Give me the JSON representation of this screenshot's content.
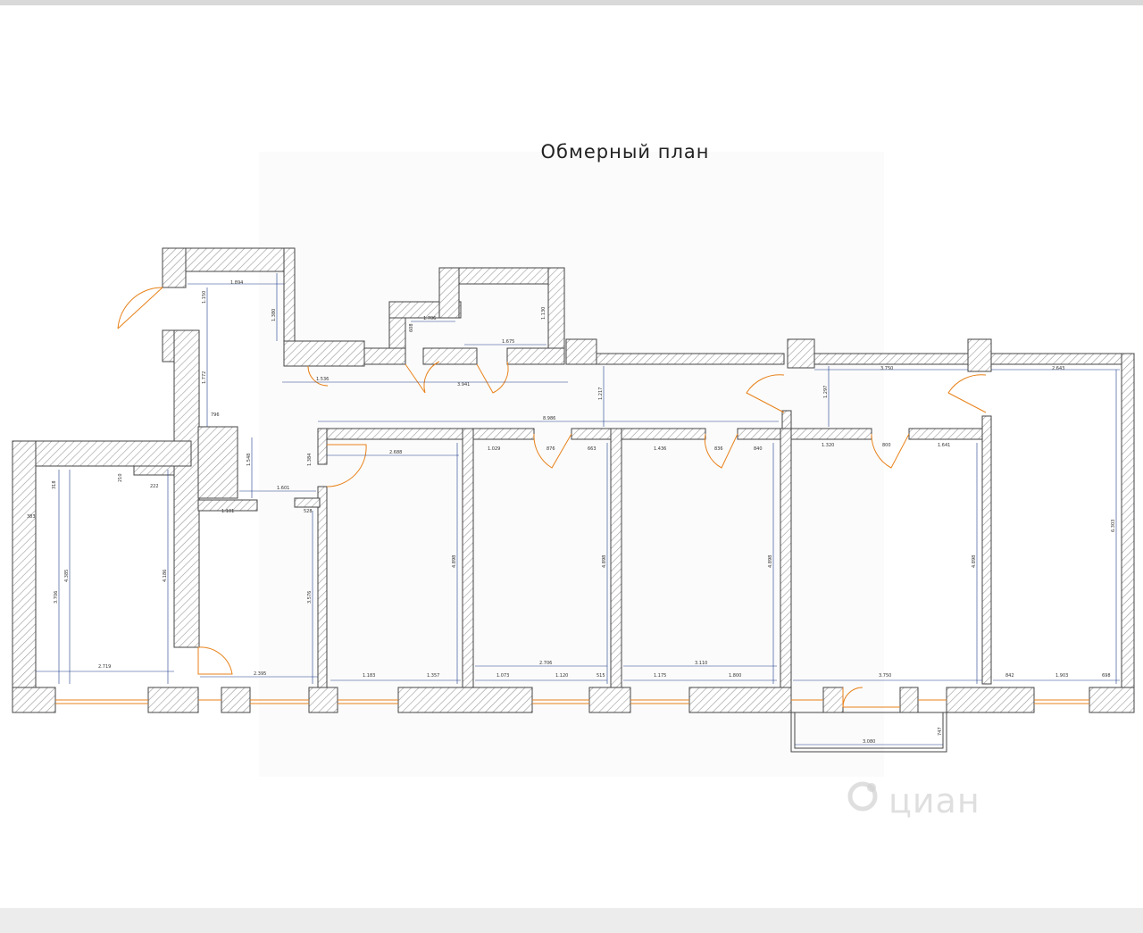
{
  "plan": {
    "title": "Обмерный план",
    "watermark": "циан",
    "colors": {
      "wall": "#444444",
      "hatch": "#9a9a9a",
      "door": "#e8821a",
      "dimension": "#1e3c8c",
      "window": "#e8821a"
    },
    "dimensions": {
      "top_corridor": "1.894",
      "corridor_h1": "1.150",
      "corridor_h2": "1.380",
      "closet_w": "1.706",
      "closet_h": "608",
      "wc_w": "1.675",
      "wc_h": "1.130",
      "door_a": "1.536",
      "door_b": "3.941",
      "hall_h": "1.217",
      "hall_long": "8.986",
      "room_r5_top": "3.750",
      "room_r6_top": "2.643",
      "hall_r5_h": "1.297",
      "c1": "1.772",
      "c2": "796",
      "c3": "1.548",
      "c4": "1.601",
      "c5": "1.384",
      "c6": "1.101",
      "c7": "528",
      "left_a": "318",
      "left_b": "222",
      "left_c": "210",
      "left_d": "383",
      "left_h1": "3.706",
      "left_h2": "4.385",
      "left_h3": "4.186",
      "left_w": "2.719",
      "corr_w": "2.395",
      "corr_h": "3.576",
      "r1_top": "2.688",
      "r1_h": "4.898",
      "r1_b1": "1.183",
      "r1_b2": "1.357",
      "r2_t1": "1.029",
      "r2_t2": "876",
      "r2_t3": "663",
      "r2_h": "4.898",
      "r2_w": "2.706",
      "r2_b1": "1.073",
      "r2_b2": "1.120",
      "r2_b3": "515",
      "r3_t1": "1.436",
      "r3_t2": "836",
      "r3_t3": "840",
      "r3_h": "4.898",
      "r3_w": "3.110",
      "r3_b1": "1.175",
      "r3_b2": "1.800",
      "r4_t1": "1.320",
      "r4_t2": "800",
      "r4_t3": "1.641",
      "r4_h": "4.898",
      "r4_w": "3.750",
      "r5_h": "6.303",
      "r5_b1": "842",
      "r5_b2": "1.903",
      "r5_b3": "698",
      "balcony_w": "3.080",
      "balcony_h": "747"
    }
  }
}
